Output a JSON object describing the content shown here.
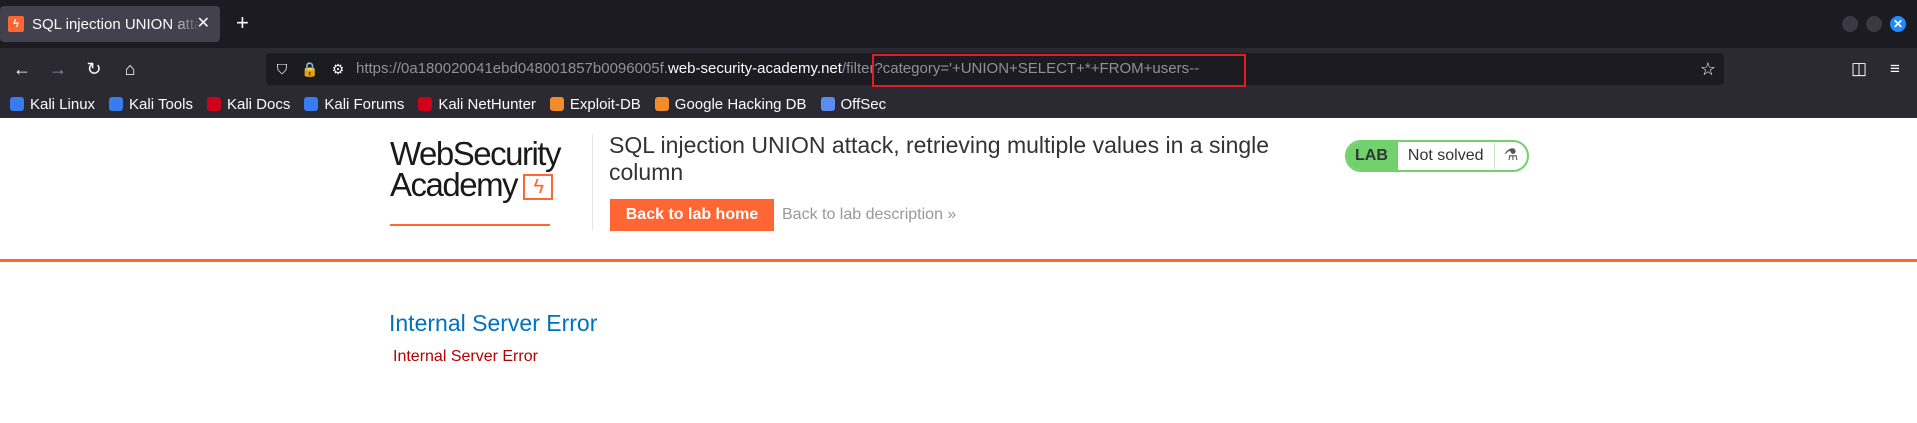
{
  "browser": {
    "tab_title": "SQL injection UNION attack, retrieving multiple values in a single column",
    "tab_favicon": "ϟ",
    "tab_close": "✕",
    "new_tab": "+",
    "window_close": "✕",
    "nav": {
      "back": "←",
      "forward": "→",
      "reload": "↻",
      "home": "⌂"
    },
    "url": {
      "prefix": "https://0a180020041ebd048001857b0096005f.",
      "domain": "web-security-academy.net",
      "path": "/filter?category='+UNION+SELECT+*+FROM+users--"
    },
    "url_icons": {
      "shield": "⛉",
      "lock": "🔒",
      "permissions": "⚙"
    },
    "right_icons": {
      "bookmark_star": "☆",
      "pocket": "◫",
      "menu": "≡"
    },
    "bookmarks": [
      {
        "label": "Kali Linux",
        "color": "#367bf0"
      },
      {
        "label": "Kali Tools",
        "color": "#367bf0"
      },
      {
        "label": "Kali Docs",
        "color": "#d0021b"
      },
      {
        "label": "Kali Forums",
        "color": "#367bf0"
      },
      {
        "label": "Kali NetHunter",
        "color": "#d0021b"
      },
      {
        "label": "Exploit-DB",
        "color": "#f28c28"
      },
      {
        "label": "Google Hacking DB",
        "color": "#f28c28"
      },
      {
        "label": "OffSec",
        "color": "#5b8def"
      }
    ]
  },
  "page": {
    "logo_line1": "WebSecurity",
    "logo_line2": "Academy",
    "logo_mark": "ϟ",
    "lab_title": "SQL injection UNION attack, retrieving multiple values in a single column",
    "back_home_label": "Back to lab home",
    "back_desc_label": "Back to lab description »",
    "status_lab": "LAB",
    "status_text": "Not solved",
    "status_icon": "⚗",
    "error_title": "Internal Server Error",
    "error_body": "Internal Server Error"
  },
  "colors": {
    "accent": "#ff6633",
    "status_green": "#70d16d",
    "link_blue": "#0071bc",
    "error_red": "#b30000",
    "highlight_red": "#e02020"
  }
}
